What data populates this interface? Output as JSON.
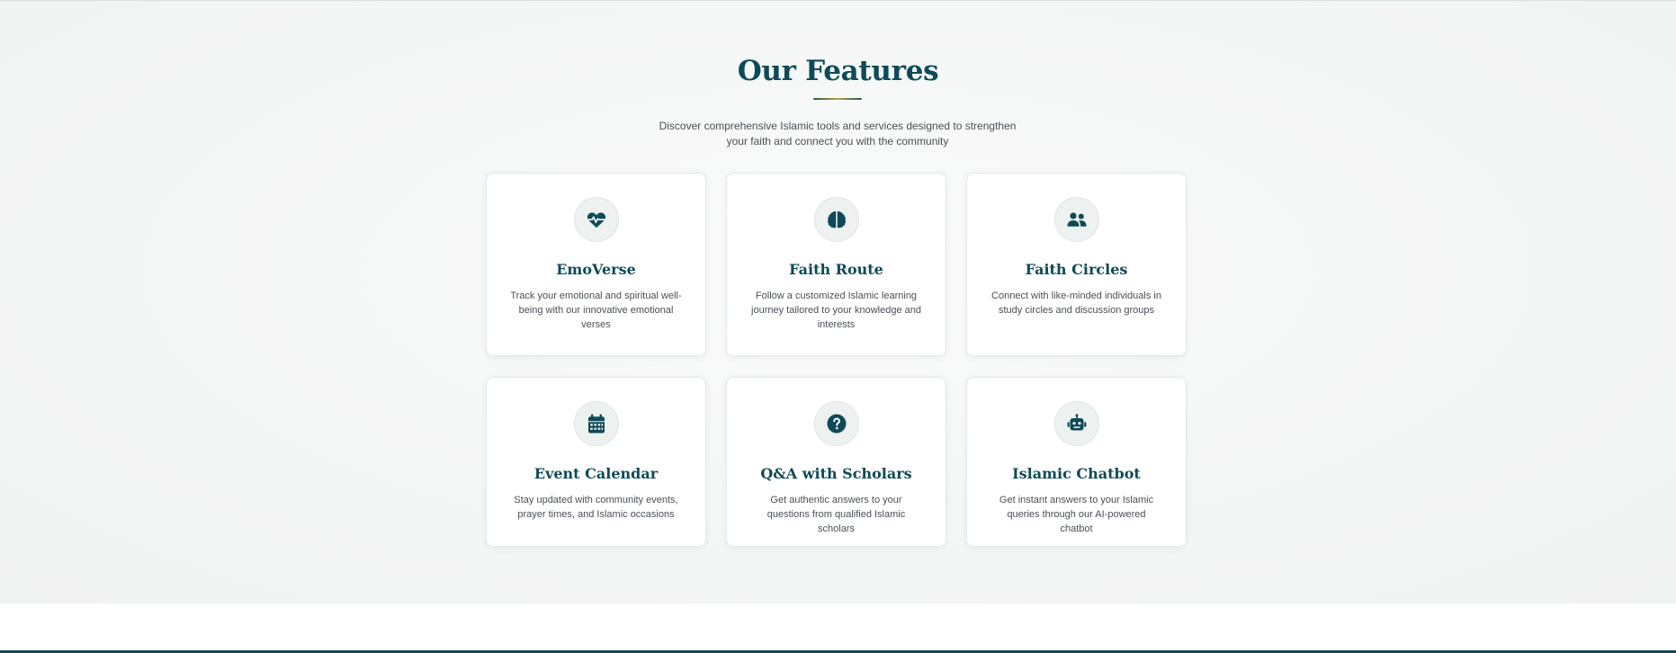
{
  "features": {
    "title": "Our Features",
    "subtitle": "Discover comprehensive Islamic tools and services designed to strengthen your faith and connect you with the community",
    "cards": [
      {
        "icon": "heart-pulse-icon",
        "title": "EmoVerse",
        "description": "Track your emotional and spiritual well-being with our innovative emotional verses"
      },
      {
        "icon": "brain-icon",
        "title": "Faith Route",
        "description": "Follow a customized Islamic learning journey tailored to your knowledge and interests"
      },
      {
        "icon": "users-icon",
        "title": "Faith Circles",
        "description": "Connect with like-minded individuals in study circles and discussion groups"
      },
      {
        "icon": "calendar-icon",
        "title": "Event Calendar",
        "description": "Stay updated with community events, prayer times, and Islamic occasions"
      },
      {
        "icon": "question-circle-icon",
        "title": "Q&A with Scholars",
        "description": "Get authentic answers to your questions from qualified Islamic scholars"
      },
      {
        "icon": "robot-icon",
        "title": "Islamic Chatbot",
        "description": "Get instant answers to your Islamic queries through our AI-powered chatbot"
      }
    ]
  },
  "colors": {
    "primary": "#0f4a58",
    "accent_gold": "#b9a23c",
    "background": "#f5f6f6",
    "text_muted": "#4a4f55"
  }
}
